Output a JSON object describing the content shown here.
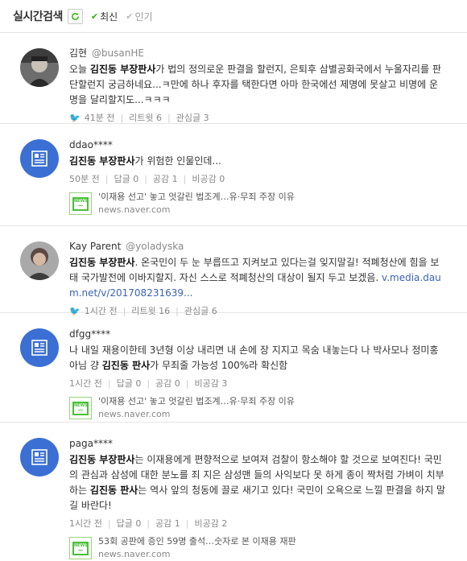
{
  "header": {
    "title": "실시간검색",
    "sort_latest": "최신",
    "sort_popular": "인기"
  },
  "items": [
    {
      "user": "김현",
      "handle": "@busanHE",
      "text_parts": [
        {
          "t": "오늘 "
        },
        {
          "t": "김진동 부장판사",
          "b": true
        },
        {
          "t": "가 법의 정의로운 판결을 할런지, 은퇴후 삼별공화국에서 누울자리를 판단할런지 궁금하네요...ㅋ만에 하나 후자를 택한다면 아마 한국에선 제명에 못살고 비명에 운명을 달리할지도...ㅋㅋㅋ"
        }
      ],
      "meta": [
        "41분 전",
        "리트윗 6",
        "관심글 3"
      ],
      "source": "twitter"
    },
    {
      "user": "ddao****",
      "text_parts": [
        {
          "t": "김진동 부장판사",
          "b": true
        },
        {
          "t": "가 위험한 인물인데..."
        }
      ],
      "meta": [
        "50분 전",
        "답글 0",
        "공감 1",
        "비공감 0"
      ],
      "news": {
        "title": "'이재용 선고' 놓고 엇갈린 법조계…유·무죄 주장 이유",
        "source": "news.naver.com"
      }
    },
    {
      "user": "Kay Parent",
      "handle": "@yoladyska",
      "text_parts": [
        {
          "t": "김진동 부장판사",
          "b": true
        },
        {
          "t": ". 온국민이 두 눈 부릅뜨고 지켜보고 있다는걸 잊지말길! 적폐청산에 힘을 보태 국가발전에 이바지할지. 자신 스스로 적폐청산의 대상이 될지 두고 보겠음. "
        },
        {
          "t": "v.media.daum.net/v/201708231639...",
          "link": true
        }
      ],
      "meta": [
        "1시간 전",
        "리트윗 16",
        "관심글 6"
      ],
      "source": "twitter"
    },
    {
      "user": "dfgg****",
      "text_parts": [
        {
          "t": "나 내일 재용이한테 3년형 이상 내리면 내 손에 장 지지고 목숨 내놓는다 나 박사모나 정미홍 아님 걍 "
        },
        {
          "t": "김진동 판사",
          "b": true
        },
        {
          "t": "가 무죄줄 가능성 100%라 확신함"
        }
      ],
      "meta": [
        "1시간 전",
        "답글 0",
        "공감 0",
        "비공감 3"
      ],
      "news": {
        "title": "'이재용 선고' 놓고 엇갈린 법조계…유·무죄 주장 이유",
        "source": "news.naver.com"
      }
    },
    {
      "user": "paga****",
      "text_parts": [
        {
          "t": "김진동 부장판사",
          "b": true
        },
        {
          "t": "는 이재용에게 편향적으로 보여져 검찰이 항소해야 할 것으로 보여진다! 국민의 관심과 삼성에 대한 분노를 죄 지은 삼성맨 들의 사익보다 못 하게 종이 짝처럼 가벼이 치부하는 "
        },
        {
          "t": "김진동 판사",
          "b": true
        },
        {
          "t": "는 역사 앞의 청동에 끌로 새기고 있다! 국민이 오욕으로 느낄 판결을 하지 말길 바란다!"
        }
      ],
      "meta": [
        "1시간 전",
        "답글 0",
        "공감 1",
        "비공감 2"
      ],
      "news": {
        "title": "53회 공판에 증인 59명 출석…숫자로 본 이재용 재판",
        "source": "news.naver.com"
      }
    }
  ],
  "colors": {
    "accent_green": "#2db400",
    "blog_blue": "#3b6fd3",
    "link_blue": "#3a63b8",
    "twitter_blue": "#1da1f2"
  }
}
